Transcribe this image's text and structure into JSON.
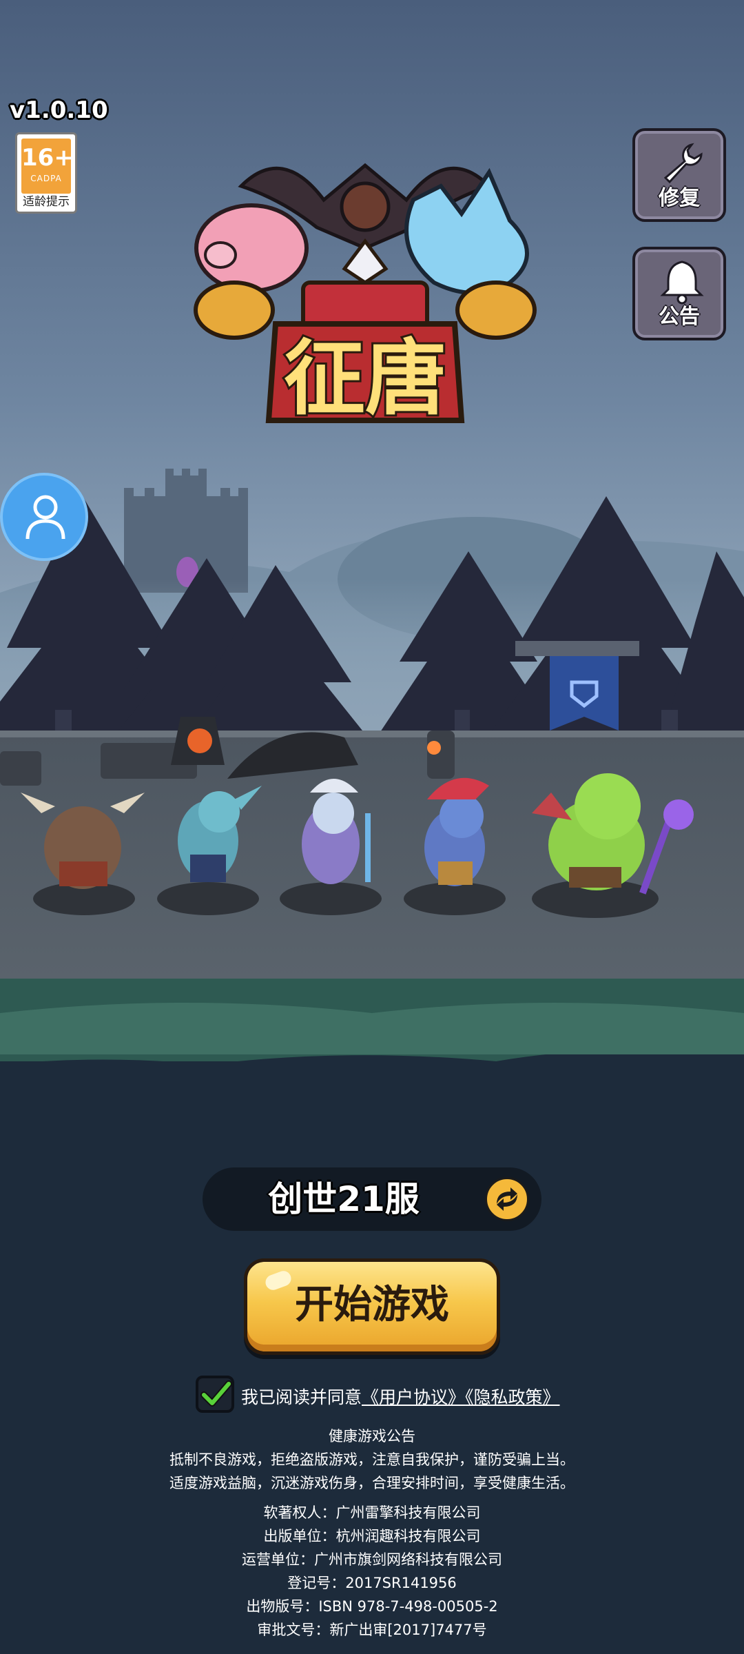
{
  "version": "v1.0.10",
  "age_rating": {
    "number": "16+",
    "org": "CADPA",
    "tip": "适龄提示"
  },
  "side_buttons": {
    "repair_label": "修复",
    "notice_label": "公告"
  },
  "logo": {
    "title": "征唐"
  },
  "server": {
    "name": "创世21服"
  },
  "start_button": {
    "label": "开始游戏"
  },
  "agreement": {
    "checked": true,
    "prefix": "我已阅读并同意",
    "user_agreement": "《用户协议》",
    "privacy_policy": "《隐私政策》"
  },
  "health_notice": {
    "title": "健康游戏公告",
    "line1": "抵制不良游戏，拒绝盗版游戏，注意自我保护，谨防受骗上当。",
    "line2": "适度游戏益脑，沉迷游戏伤身，合理安排时间，享受健康生活。"
  },
  "credits": {
    "copyright": "软著权人：广州雷擎科技有限公司",
    "publisher": "出版单位：杭州润趣科技有限公司",
    "operator": "运营单位：广州市旗剑网络科技有限公司",
    "registration": "登记号：2017SR141956",
    "isbn": "出物版号：ISBN 978-7-498-00505-2",
    "approval": "审批文号：新广出审[2017]7477号"
  },
  "colors": {
    "sky_top": "#4a5e7c",
    "sky_bottom": "#8fa5b8",
    "ground_bottom": "#1d2b3b",
    "start_button": "#f7c74b",
    "server_bar": "#121a24",
    "avatar_button": "#4aa3ee"
  },
  "icons": {
    "repair": "wrench-icon",
    "notice": "bell-icon",
    "account": "user-icon",
    "switch_server": "swap-arrows-icon",
    "checkbox": "checkmark-icon"
  }
}
